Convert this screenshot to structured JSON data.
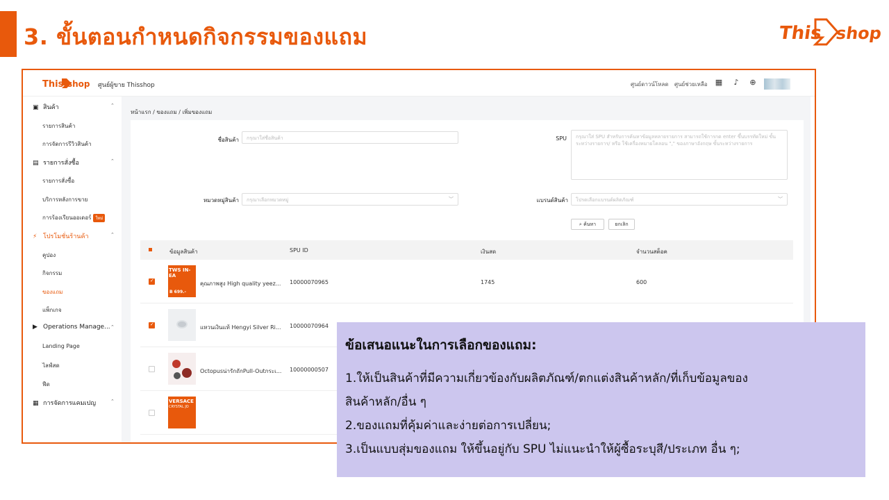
{
  "slide": {
    "title": "3. ขั้นตอนกำหนดกิจกรรมของแถม",
    "brand": {
      "this": "This",
      "shop": "shop"
    },
    "accent_color": "#e8590c"
  },
  "app": {
    "brand": {
      "this": "This",
      "shop": "shop"
    },
    "title": "ศูนย์ผู้ขาย Thisshop",
    "top_links": [
      "ศูนย์ดาวน์โหลด",
      "ศูนย์ช่วยเหลือ"
    ],
    "top_icons": [
      "qr-code-icon",
      "bell-icon",
      "globe-icon"
    ]
  },
  "sidebar": {
    "groups": [
      {
        "icon": "product-icon",
        "glyph": "▣",
        "label": "สินค้า",
        "items": [
          "รายการสินค้า",
          "การจัดการรีวิวสินค้า"
        ]
      },
      {
        "icon": "order-icon",
        "glyph": "▤",
        "label": "รายการสั่งซื้อ",
        "items": [
          "รายการสั่งซื้อ",
          "บริการหลังการขาย",
          "การร้องเรียนออเดอร์"
        ],
        "badge": "ใหม่"
      },
      {
        "icon": "promotion-icon",
        "glyph": "⚡",
        "label": "โปรโมชั่นร้านค้า",
        "items": [
          "คูปอง",
          "กิจกรรม",
          "ของแถม",
          "แพ็กเกจ"
        ],
        "active_item": "ของแถม"
      },
      {
        "icon": "operations-icon",
        "glyph": "▶",
        "label": "Operations Manage...",
        "items": [
          "Landing Page",
          "ไลฟ์สด",
          "ฟีด"
        ]
      },
      {
        "icon": "campaign-icon",
        "glyph": "▦",
        "label": "การจัดการแคมเปญ",
        "items": []
      }
    ]
  },
  "breadcrumb": "หน้าแรก  /  ของแถม  /  เพิ่มของแถม",
  "form": {
    "product_name_label": "ชื่อสินค้า",
    "product_name_placeholder": "กรุณาใส่ชื่อสินค้า",
    "spu_label": "SPU",
    "spu_placeholder": "กรุณาใส่ SPU สำหรับการค้นหาข้อมูลหลายรายการ สามารถใช้การกด enter ขึ้นบรรทัดใหม่ ขั้นระหว่างรายการ/ หรือ ใช้เครื่องหมายโคลอน \",\" ของภาษาอังกฤษ ขั้นระหว่างรายการ",
    "category_label": "หมวดหมู่สินค้า",
    "category_placeholder": "กรุณาเลือกหมวดหมู่",
    "brand_label": "แบรนด์สินค้า",
    "brand_placeholder": "โปรดเลือกแบรนด์ผลิตภัณฑ์",
    "search_button": "ค้นหา",
    "cancel_button": "ยกเลิก"
  },
  "table": {
    "columns": [
      "ข้อมูลสินค้า",
      "SPU ID",
      "เงินสด",
      "จำนวนสต็อค"
    ],
    "rows": [
      {
        "name": "คุณภาพสูง High quality yeez...",
        "spu": "10000070965",
        "cash": "1745",
        "stock": "600",
        "checked": true,
        "thumb_text": "TWS IN-EA",
        "thumb_price": "B 699.-"
      },
      {
        "name": "แหวนเงินแท้ Hengyi Silver Ri...",
        "spu": "10000070964",
        "cash": "",
        "stock": "",
        "checked": true,
        "thumb_text": "",
        "thumb_price": ""
      },
      {
        "name": "Octopusน่ารักถักPull-Outกระเ...",
        "spu": "10000000507",
        "cash": "",
        "stock": "",
        "checked": false,
        "thumb_text": "",
        "thumb_price": ""
      },
      {
        "name": "",
        "spu": "",
        "cash": "",
        "stock": "",
        "checked": false,
        "thumb_text": "VERSACE",
        "thumb_price": "CRYSTAL JO"
      }
    ]
  },
  "note": {
    "title": "ข้อเสนอแนะในการเลือกของแถม:",
    "lines": [
      "1.ให้เป็นสินค้าที่มีความเกี่ยวข้องกับผลิตภัณฑ์/ตกแต่งสินค้าหลัก/ที่เก็บข้อมูลของ",
      "สินค้าหลัก/อื่น ๆ",
      "2.ของแถมที่คุ้มค่าและง่ายต่อการเปลี่ยน;",
      "3.เป็นแบบสุ่มของแถม ให้ขึ้นอยู่กับ SPU ไม่แนะนำให้ผู้ซื้อระบุสี/ประเภท อื่น ๆ;"
    ],
    "background": "#ccc6ee"
  }
}
